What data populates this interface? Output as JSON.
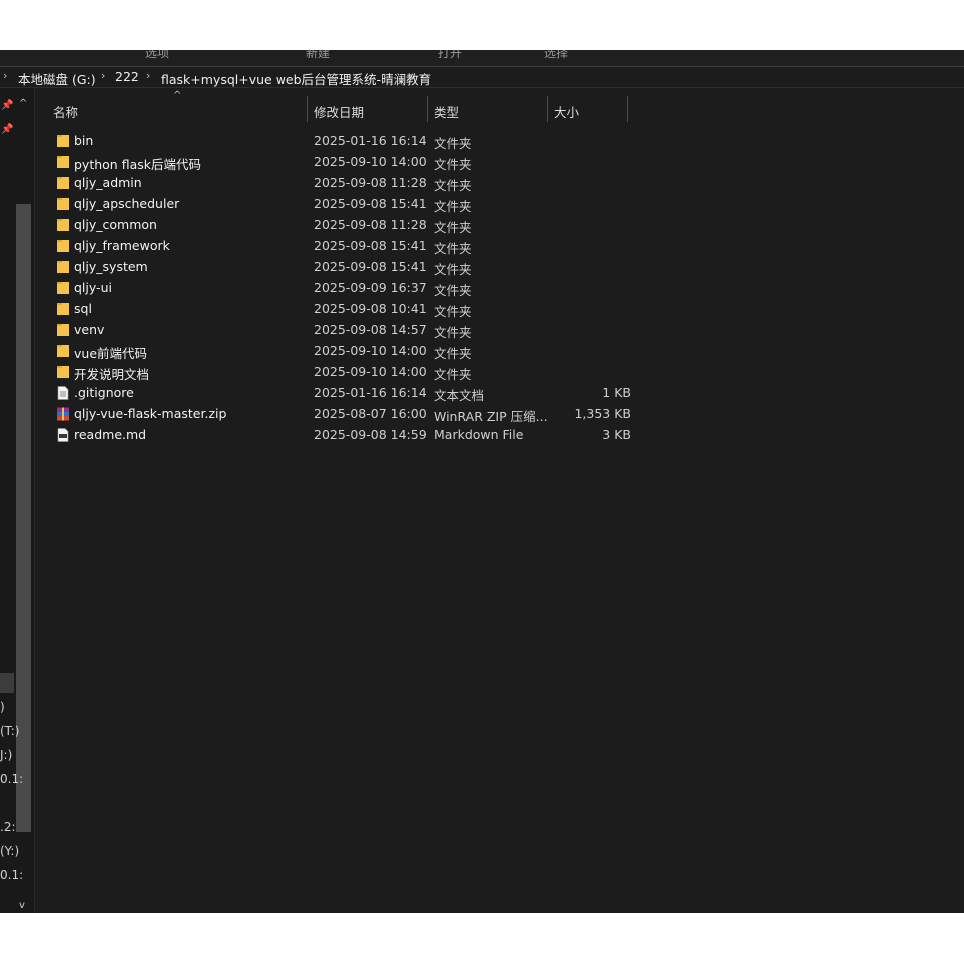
{
  "ribbon": {
    "items": [
      "选项",
      "新建",
      "打开",
      "选择"
    ]
  },
  "breadcrumb": {
    "items": [
      "本地磁盘 (G:)",
      "222",
      "flask+mysql+vue web后台管理系统-晴澜教育"
    ],
    "separator": "›"
  },
  "nav": {
    "labels": [
      ")",
      "(T:)",
      "J:)",
      "0.1:",
      ".2:",
      "(Y:)",
      "0.1:"
    ]
  },
  "columns": {
    "name": "名称",
    "date": "修改日期",
    "type": "类型",
    "size": "大小",
    "sort_indicator": "^"
  },
  "files": [
    {
      "name": "bin",
      "date": "2025-01-16 16:14",
      "type": "文件夹",
      "size": "",
      "icon": "folder-icon"
    },
    {
      "name": "python flask后端代码",
      "date": "2025-09-10 14:00",
      "type": "文件夹",
      "size": "",
      "icon": "folder-icon"
    },
    {
      "name": "qljy_admin",
      "date": "2025-09-08 11:28",
      "type": "文件夹",
      "size": "",
      "icon": "folder-icon"
    },
    {
      "name": "qljy_apscheduler",
      "date": "2025-09-08 15:41",
      "type": "文件夹",
      "size": "",
      "icon": "folder-icon"
    },
    {
      "name": "qljy_common",
      "date": "2025-09-08 11:28",
      "type": "文件夹",
      "size": "",
      "icon": "folder-icon"
    },
    {
      "name": "qljy_framework",
      "date": "2025-09-08 15:41",
      "type": "文件夹",
      "size": "",
      "icon": "folder-icon"
    },
    {
      "name": "qljy_system",
      "date": "2025-09-08 15:41",
      "type": "文件夹",
      "size": "",
      "icon": "folder-icon"
    },
    {
      "name": "qljy-ui",
      "date": "2025-09-09 16:37",
      "type": "文件夹",
      "size": "",
      "icon": "folder-icon"
    },
    {
      "name": "sql",
      "date": "2025-09-08 10:41",
      "type": "文件夹",
      "size": "",
      "icon": "folder-icon"
    },
    {
      "name": "venv",
      "date": "2025-09-08 14:57",
      "type": "文件夹",
      "size": "",
      "icon": "folder-icon"
    },
    {
      "name": "vue前端代码",
      "date": "2025-09-10 14:00",
      "type": "文件夹",
      "size": "",
      "icon": "folder-icon"
    },
    {
      "name": "开发说明文档",
      "date": "2025-09-10 14:00",
      "type": "文件夹",
      "size": "",
      "icon": "folder-icon"
    },
    {
      "name": ".gitignore",
      "date": "2025-01-16 16:14",
      "type": "文本文档",
      "size": "1 KB",
      "icon": "text-file-icon"
    },
    {
      "name": "qljy-vue-flask-master.zip",
      "date": "2025-08-07 16:00",
      "type": "WinRAR ZIP 压缩...",
      "size": "1,353 KB",
      "icon": "winrar-archive-icon"
    },
    {
      "name": "readme.md",
      "date": "2025-09-08 14:59",
      "type": "Markdown File",
      "size": "3 KB",
      "icon": "markdown-file-icon"
    }
  ],
  "colors": {
    "folder": "#f5c24a",
    "background": "#1c1c1c"
  }
}
